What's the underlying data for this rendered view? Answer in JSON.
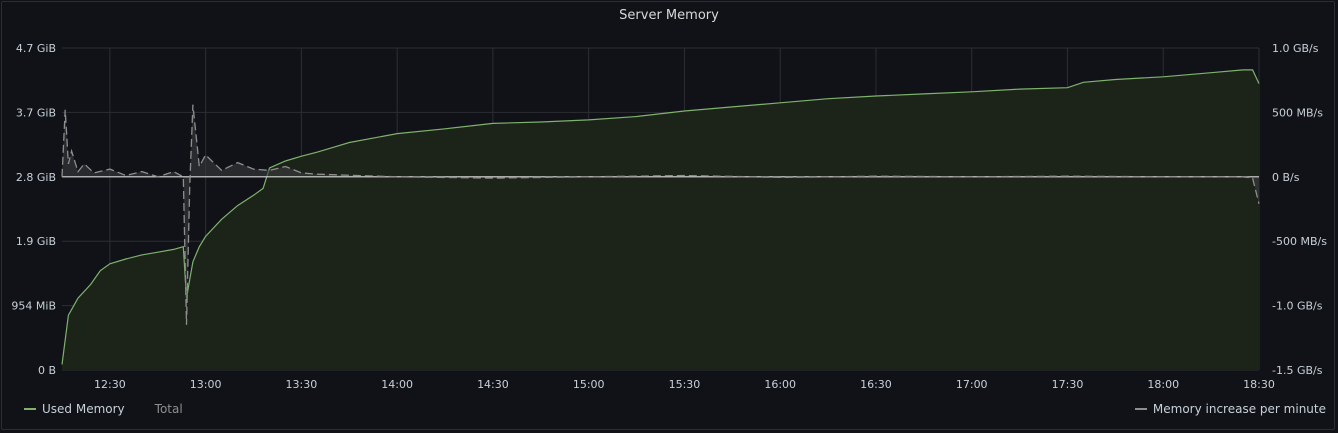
{
  "panel": {
    "title": "Server Memory"
  },
  "legend": {
    "used_memory": "Used Memory",
    "total": "Total",
    "rate": "Memory increase per minute"
  },
  "colors": {
    "used": "#7eb26d",
    "used_fill": "#1c2419",
    "rate": "#8e8e8e",
    "grid": "#2c2e33"
  },
  "chart_data": {
    "type": "line",
    "x_ticks": [
      "12:30",
      "13:00",
      "13:30",
      "14:00",
      "14:30",
      "15:00",
      "15:30",
      "16:00",
      "16:30",
      "17:00",
      "17:30",
      "18:00",
      "18:30"
    ],
    "y_left_ticks": [
      "0 B",
      "954 MiB",
      "1.9 GiB",
      "2.8 GiB",
      "3.7 GiB",
      "4.7 GiB"
    ],
    "y_right_ticks": [
      "-1.5 GB/s",
      "-1.0 GB/s",
      "-500 MB/s",
      "0 B/s",
      "500 MB/s",
      "1.0 GB/s"
    ],
    "ylim_left_gib": [
      0,
      4.7
    ],
    "ylim_right_mbps": [
      -1500,
      1000
    ],
    "series": [
      {
        "name": "Used Memory",
        "axis": "left",
        "unit": "GiB",
        "x": [
          "12:15",
          "12:17",
          "12:20",
          "12:24",
          "12:27",
          "12:30",
          "12:35",
          "12:40",
          "12:45",
          "12:50",
          "12:53",
          "12:54",
          "12:55",
          "12:56",
          "12:58",
          "13:00",
          "13:05",
          "13:10",
          "13:15",
          "13:18",
          "13:20",
          "13:25",
          "13:30",
          "13:35",
          "13:40",
          "13:45",
          "14:00",
          "14:15",
          "14:30",
          "14:45",
          "15:00",
          "15:15",
          "15:30",
          "15:45",
          "16:00",
          "16:15",
          "16:30",
          "16:45",
          "17:00",
          "17:15",
          "17:30",
          "17:35",
          "17:45",
          "18:00",
          "18:15",
          "18:25",
          "18:28",
          "18:30"
        ],
        "values": [
          0.08,
          0.8,
          1.05,
          1.25,
          1.45,
          1.55,
          1.62,
          1.68,
          1.72,
          1.76,
          1.8,
          1.05,
          1.32,
          1.58,
          1.8,
          1.95,
          2.2,
          2.4,
          2.55,
          2.65,
          2.95,
          3.05,
          3.12,
          3.18,
          3.25,
          3.32,
          3.45,
          3.52,
          3.6,
          3.62,
          3.65,
          3.7,
          3.78,
          3.84,
          3.9,
          3.96,
          4.0,
          4.03,
          4.06,
          4.1,
          4.12,
          4.2,
          4.24,
          4.28,
          4.34,
          4.38,
          4.38,
          4.18
        ]
      },
      {
        "name": "Memory increase per minute",
        "axis": "right",
        "unit": "MB/s",
        "x": [
          "12:15",
          "12:16",
          "12:17",
          "12:18",
          "12:20",
          "12:22",
          "12:25",
          "12:30",
          "12:35",
          "12:40",
          "12:45",
          "12:50",
          "12:53",
          "12:54",
          "12:55",
          "12:56",
          "12:58",
          "13:00",
          "13:05",
          "13:10",
          "13:15",
          "13:20",
          "13:25",
          "13:30",
          "13:35",
          "14:00",
          "14:30",
          "15:00",
          "15:30",
          "16:00",
          "16:30",
          "17:00",
          "17:30",
          "18:00",
          "18:25",
          "18:28",
          "18:30"
        ],
        "values": [
          0,
          520,
          100,
          200,
          40,
          100,
          30,
          60,
          10,
          40,
          0,
          40,
          0,
          -1150,
          -80,
          560,
          80,
          170,
          50,
          110,
          60,
          50,
          80,
          30,
          20,
          0,
          -10,
          0,
          10,
          -5,
          5,
          0,
          5,
          0,
          0,
          -10,
          -210
        ]
      }
    ]
  }
}
